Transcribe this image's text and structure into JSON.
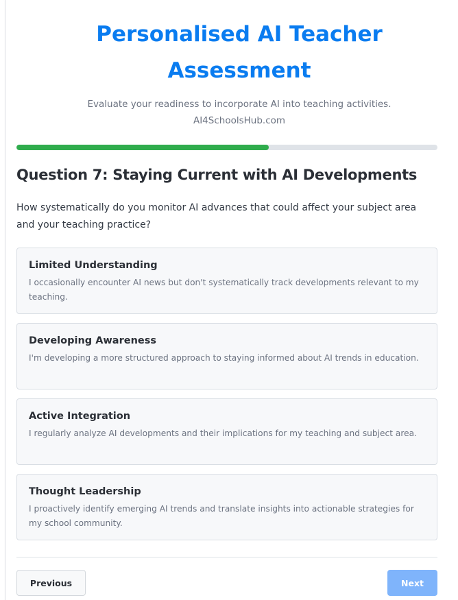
{
  "header": {
    "title_line1": "Personalised AI Teacher",
    "title_line2": "Assessment",
    "subtitle_line1": "Evaluate your readiness to incorporate AI into teaching activities.",
    "subtitle_line2": "AI4SchoolsHub.com"
  },
  "progress": {
    "percent": 60,
    "color": "#2fac4c"
  },
  "question": {
    "title": "Question 7: Staying Current with AI Developments",
    "text": "How systematically do you monitor AI advances that could affect your subject area and your teaching practice?"
  },
  "options": [
    {
      "title": "Limited Understanding",
      "description": "I occasionally encounter AI news but don't systematically track developments relevant to my teaching."
    },
    {
      "title": "Developing Awareness",
      "description": "I'm developing a more structured approach to staying informed about AI trends in education."
    },
    {
      "title": "Active Integration",
      "description": "I regularly analyze AI developments and their implications for my teaching and subject area."
    },
    {
      "title": "Thought Leadership",
      "description": "I proactively identify emerging AI trends and translate insights into actionable strategies for my school community."
    }
  ],
  "nav": {
    "previous_label": "Previous",
    "next_label": "Next"
  },
  "colors": {
    "accent": "#0a7cf0",
    "next_button": "#7fb4fb"
  }
}
